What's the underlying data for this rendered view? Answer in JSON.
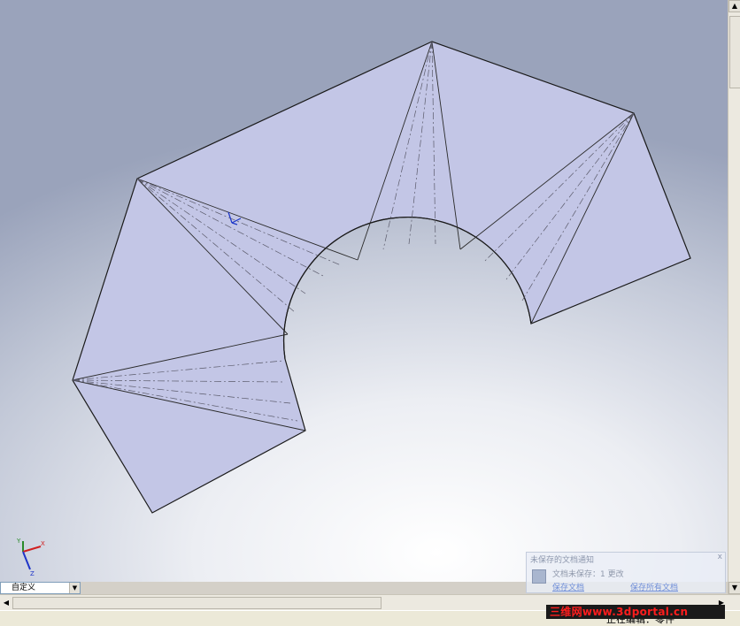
{
  "viewport": {
    "background_top": "#9aa3bb",
    "background_bottom": "#ffffff",
    "face_color": "#c3c6e6",
    "edge_color": "#1a1a1a"
  },
  "triad": {
    "x_label": "X",
    "y_label": "Y",
    "z_label": "Z"
  },
  "view_selector": {
    "value": "自定义"
  },
  "notification": {
    "title": "未保存的文档通知",
    "close_label": "x",
    "message": "文档未保存：1 更改",
    "save_link": "保存文档",
    "save_all_link": "保存所有文档"
  },
  "status_bar": {
    "text": "正在编辑：零件"
  },
  "watermark": {
    "text": "三维网www.3dportal.cn"
  },
  "scrollbars": {
    "up_arrow": "▲",
    "down_arrow": "▼",
    "left_arrow": "◀",
    "right_arrow": "▶"
  }
}
